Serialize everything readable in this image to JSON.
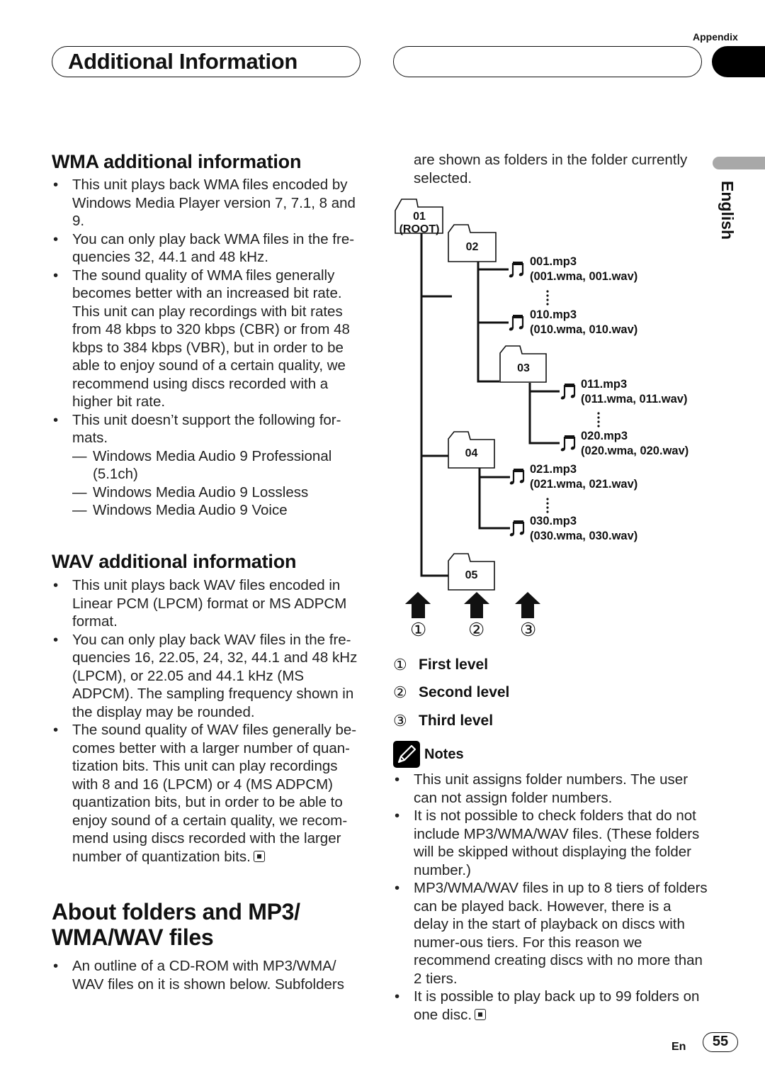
{
  "header": {
    "section_tag": "Appendix",
    "title": "Additional Information",
    "language_tab": "English"
  },
  "wma": {
    "heading": "WMA additional information",
    "bullets": [
      "This unit plays back WMA files encoded by Windows Media Player version 7, 7.1, 8 and 9.",
      "You can only play back WMA files in the fre-quencies 32, 44.1 and 48 kHz.",
      "The sound quality of WMA files generally becomes better with an increased bit rate. This unit can play recordings with bit rates from 48 kbps to 320 kbps (CBR) or from 48 kbps to 384 kbps (VBR), but in order to be able to enjoy sound of a certain quality, we recommend using discs recorded with a higher bit rate.",
      "This unit doesn’t support the following for-mats."
    ],
    "unsupported": [
      "Windows Media Audio 9 Professional (5.1ch)",
      "Windows Media Audio 9 Lossless",
      "Windows Media Audio 9 Voice"
    ]
  },
  "wav": {
    "heading": "WAV additional information",
    "bullets": [
      "This unit plays back WAV files encoded in Linear PCM (LPCM) format or MS ADPCM format.",
      "You can only play back WAV files in the fre-quencies 16, 22.05, 24, 32, 44.1 and 48 kHz (LPCM), or 22.05 and 44.1 kHz (MS ADPCM). The sampling frequency shown in the display may be rounded.",
      "The sound quality of WAV files generally be-comes better with a larger number of quan-tization bits. This unit can play recordings with 8 and 16 (LPCM) or 4 (MS ADPCM) quantization bits, but in order to be able to enjoy sound of a certain quality, we recom-mend using discs recorded with the larger number of quantization bits."
    ]
  },
  "folders": {
    "heading_line1": "About folders and MP3/",
    "heading_line2": "WMA/WAV files",
    "intro": "An outline of a CD-ROM with MP3/WMA/ WAV files on it is shown below. Subfolders",
    "intro_cont": "are shown as folders in the folder currently selected."
  },
  "tree": {
    "folders": [
      {
        "id": "01",
        "sub": "(ROOT)"
      },
      {
        "id": "02"
      },
      {
        "id": "03"
      },
      {
        "id": "04"
      },
      {
        "id": "05"
      }
    ],
    "files": [
      {
        "name": "001.mp3",
        "alt": "(001.wma, 001.wav)"
      },
      {
        "name": "010.mp3",
        "alt": "(010.wma, 010.wav)"
      },
      {
        "name": "011.mp3",
        "alt": "(011.wma, 011.wav)"
      },
      {
        "name": "020.mp3",
        "alt": "(020.wma, 020.wav)"
      },
      {
        "name": "021.mp3",
        "alt": "(021.wma, 021.wav)"
      },
      {
        "name": "030.mp3",
        "alt": "(030.wma, 030.wav)"
      }
    ],
    "level_markers": [
      "①",
      "②",
      "③"
    ]
  },
  "legend": [
    {
      "num": "①",
      "label": "First level"
    },
    {
      "num": "②",
      "label": "Second level"
    },
    {
      "num": "③",
      "label": "Third level"
    }
  ],
  "notes": {
    "title": "Notes",
    "items": [
      "This unit assigns folder numbers. The user can not assign folder numbers.",
      "It is not possible to check folders that do not include MP3/WMA/WAV files. (These folders will be skipped without displaying the folder number.)",
      "MP3/WMA/WAV files in up to 8 tiers of folders can be played back. However, there is a delay in the start of playback on discs with numer-ous tiers. For this reason we recommend creating discs with no more than 2 tiers.",
      "It is possible to play back up to 99 folders on one disc."
    ]
  },
  "footer": {
    "lang_code": "En",
    "page_number": "55"
  }
}
